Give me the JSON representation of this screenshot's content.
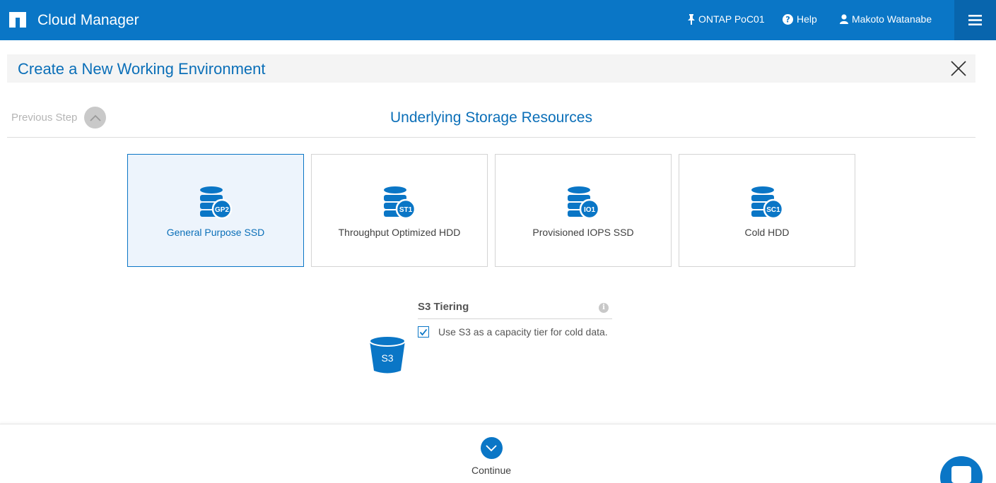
{
  "topbar": {
    "app_title": "Cloud Manager",
    "working_env": "ONTAP PoC01",
    "help": "Help",
    "user": "Makoto Watanabe",
    "bg_color": "#0a76c6"
  },
  "page": {
    "title": "Create a New Working Environment"
  },
  "step": {
    "previous_label": "Previous Step",
    "title": "Underlying Storage Resources"
  },
  "storage_types": [
    {
      "label": "General Purpose SSD",
      "badge": "GP2",
      "selected": true
    },
    {
      "label": "Throughput Optimized HDD",
      "badge": "ST1",
      "selected": false
    },
    {
      "label": "Provisioned IOPS SSD",
      "badge": "IO1",
      "selected": false
    },
    {
      "label": "Cold HDD",
      "badge": "SC1",
      "selected": false
    }
  ],
  "s3_tiering": {
    "title": "S3 Tiering",
    "bucket_label": "S3",
    "checkbox_label": "Use S3 as a capacity tier for cold data.",
    "checked": true
  },
  "footer": {
    "continue_label": "Continue"
  },
  "icons": {
    "logo": "netapp-logo-icon",
    "pin": "pin-icon",
    "help": "question-circle-icon",
    "user": "user-icon",
    "menu": "hamburger-menu-icon",
    "close": "close-icon",
    "previous": "chevron-up-icon",
    "continue": "chevron-down-icon",
    "info": "info-icon",
    "chat": "chat-icon"
  }
}
